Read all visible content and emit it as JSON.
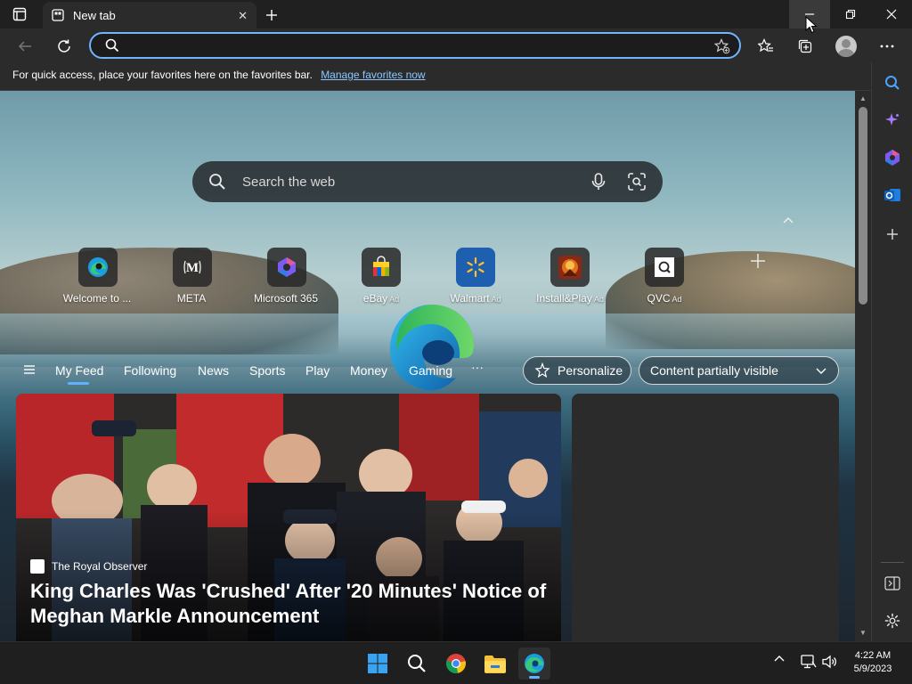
{
  "browser": {
    "tab_title": "New tab",
    "address_placeholder": "",
    "favorites_bar": {
      "message": "For quick access, place your favorites here on the favorites bar.",
      "link": "Manage favorites now"
    }
  },
  "newtab": {
    "search_placeholder": "Search the web",
    "quick_links": [
      {
        "label": "Welcome to ...",
        "ad": ""
      },
      {
        "label": "META",
        "ad": ""
      },
      {
        "label": "Microsoft 365",
        "ad": ""
      },
      {
        "label": "eBay",
        "ad": "Ad"
      },
      {
        "label": "Walmart",
        "ad": "Ad"
      },
      {
        "label": "Install&Play",
        "ad": "Ad"
      },
      {
        "label": "QVC",
        "ad": "Ad"
      }
    ],
    "feed_nav": {
      "items": [
        "My Feed",
        "Following",
        "News",
        "Sports",
        "Play",
        "Money",
        "Gaming"
      ],
      "more": "···",
      "personalize": "Personalize",
      "visibility": "Content partially visible"
    },
    "hero": {
      "source": "The Royal Observer",
      "headline": "King Charles Was 'Crushed' After '20 Minutes' Notice of Meghan Markle Announcement"
    }
  },
  "taskbar": {
    "time": "4:22 AM",
    "date": "5/9/2023"
  },
  "colors": {
    "accent": "#5fb2ff",
    "address_border": "#6fb5ff",
    "chrome_bg": "#2b2b2b",
    "titlebar_bg": "#202020"
  }
}
